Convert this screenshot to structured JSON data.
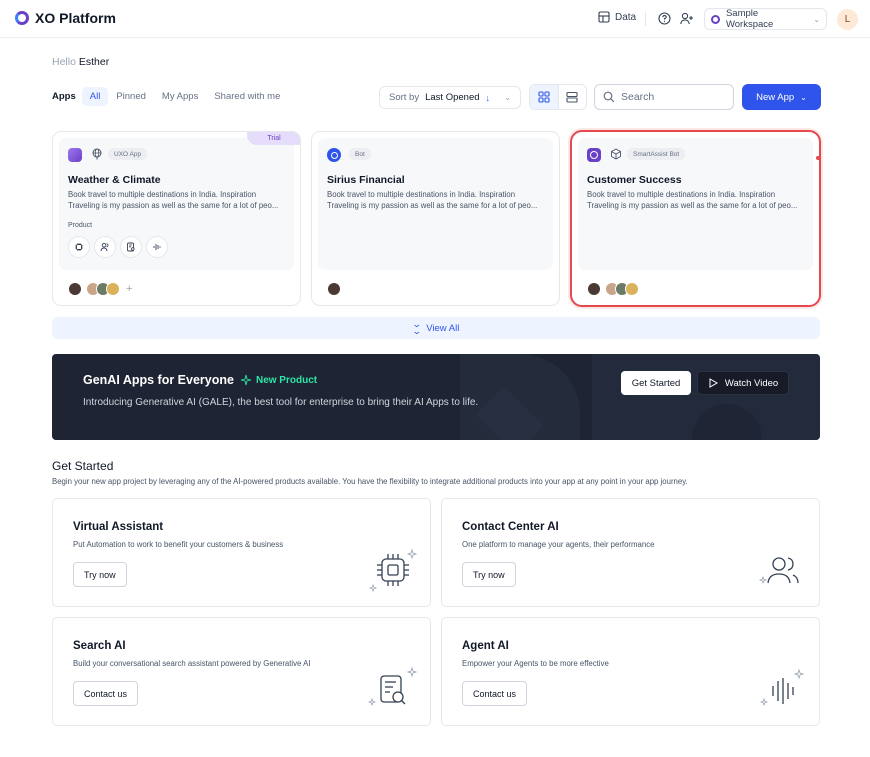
{
  "header": {
    "brand": "XO Platform",
    "data_label": "Data",
    "workspace": "Sample Workspace",
    "user_initial": "L"
  },
  "greeting": {
    "hello": "Hello",
    "name": "Esther"
  },
  "filters": {
    "section_label": "Apps",
    "tabs": [
      "All",
      "Pinned",
      "My Apps",
      "Shared with me"
    ],
    "active_tab": "All",
    "sort_label": "Sort by",
    "sort_value": "Last Opened",
    "search_placeholder": "Search",
    "new_app_label": "New App"
  },
  "apps": [
    {
      "name": "Weather & Climate",
      "type": "UXO App",
      "badge": "Trial",
      "description_line1": "Book travel to multiple destinations in India. Inspiration",
      "description_line2": "Traveling is my passion as well as the same for a lot of peo...",
      "product_label": "Product",
      "logo_color": "#7f56d9"
    },
    {
      "name": "Sirius Financial",
      "type": "Bot",
      "description_line1": "Book travel to multiple destinations in India. Inspiration",
      "description_line2": "Traveling is my passion as well as the same for a lot of peo...",
      "logo_color": "#2f54eb"
    },
    {
      "name": "Customer Success",
      "type": "SmartAssist Bot",
      "description_line1": "Book travel to multiple destinations in India. Inspiration",
      "description_line2": "Traveling is my passion as well as the same for a lot of peo...",
      "logo_color": "#7f56d9"
    }
  ],
  "view_all": "View All",
  "banner": {
    "title": "GenAI Apps for Everyone",
    "tag": "New Product",
    "subtitle": "Introducing Generative AI (GALE), the best tool for enterprise to bring their AI Apps to life.",
    "primary": "Get Started",
    "secondary": "Watch Video"
  },
  "get_started": {
    "title": "Get Started",
    "subtitle": "Begin your new app project by leveraging any of the AI-powered products available. You have the flexibility to integrate additional products into your app at any point in your app journey.",
    "cards": [
      {
        "name": "Virtual Assistant",
        "desc": "Put Automation to work to benefit your customers & business",
        "cta": "Try now",
        "icon": "chip-icon"
      },
      {
        "name": "Contact Center AI",
        "desc": "One platform to manage your agents, their performance",
        "cta": "Try now",
        "icon": "users-icon"
      },
      {
        "name": "Search AI",
        "desc": "Build your conversational search assistant powered by Generative AI",
        "cta": "Contact us",
        "icon": "document-search-icon"
      },
      {
        "name": "Agent AI",
        "desc": "Empower your Agents to be more effective",
        "cta": "Contact us",
        "icon": "waveform-icon"
      }
    ]
  },
  "colors": {
    "accent": "#2f54eb",
    "selection": "#e5484d",
    "banner_bg": "#1e2433",
    "new_tag": "#2ee6a6"
  }
}
